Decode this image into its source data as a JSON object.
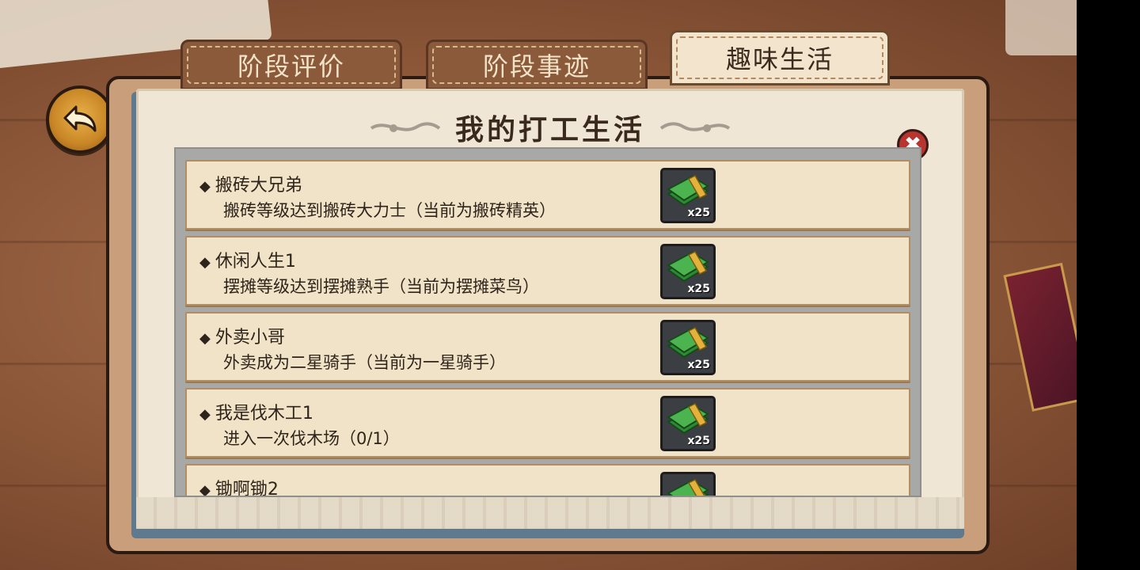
{
  "tabs": [
    {
      "label": "阶段评价"
    },
    {
      "label": "阶段事迹"
    },
    {
      "label": "趣味生活"
    }
  ],
  "panel": {
    "title": "我的打工生活"
  },
  "tasks": [
    {
      "name": "搬砖大兄弟",
      "desc": "搬砖等级达到搬砖大力士（当前为搬砖精英）",
      "reward_qty": "x25"
    },
    {
      "name": "休闲人生1",
      "desc": "摆摊等级达到摆摊熟手（当前为摆摊菜鸟）",
      "reward_qty": "x25"
    },
    {
      "name": "外卖小哥",
      "desc": "外卖成为二星骑手（当前为一星骑手）",
      "reward_qty": "x25"
    },
    {
      "name": "我是伐木工1",
      "desc": "进入一次伐木场（0/1）",
      "reward_qty": "x25"
    },
    {
      "name": "锄啊锄2",
      "desc": "",
      "reward_qty": ""
    }
  ],
  "icons": {
    "back": "back-arrow-icon",
    "close": "close-icon",
    "reward": "cash-bundle-icon",
    "close_symbol": "✖"
  },
  "colors": {
    "accent": "#c98626",
    "close": "#b8352f",
    "parchment": "#efe6d6"
  }
}
